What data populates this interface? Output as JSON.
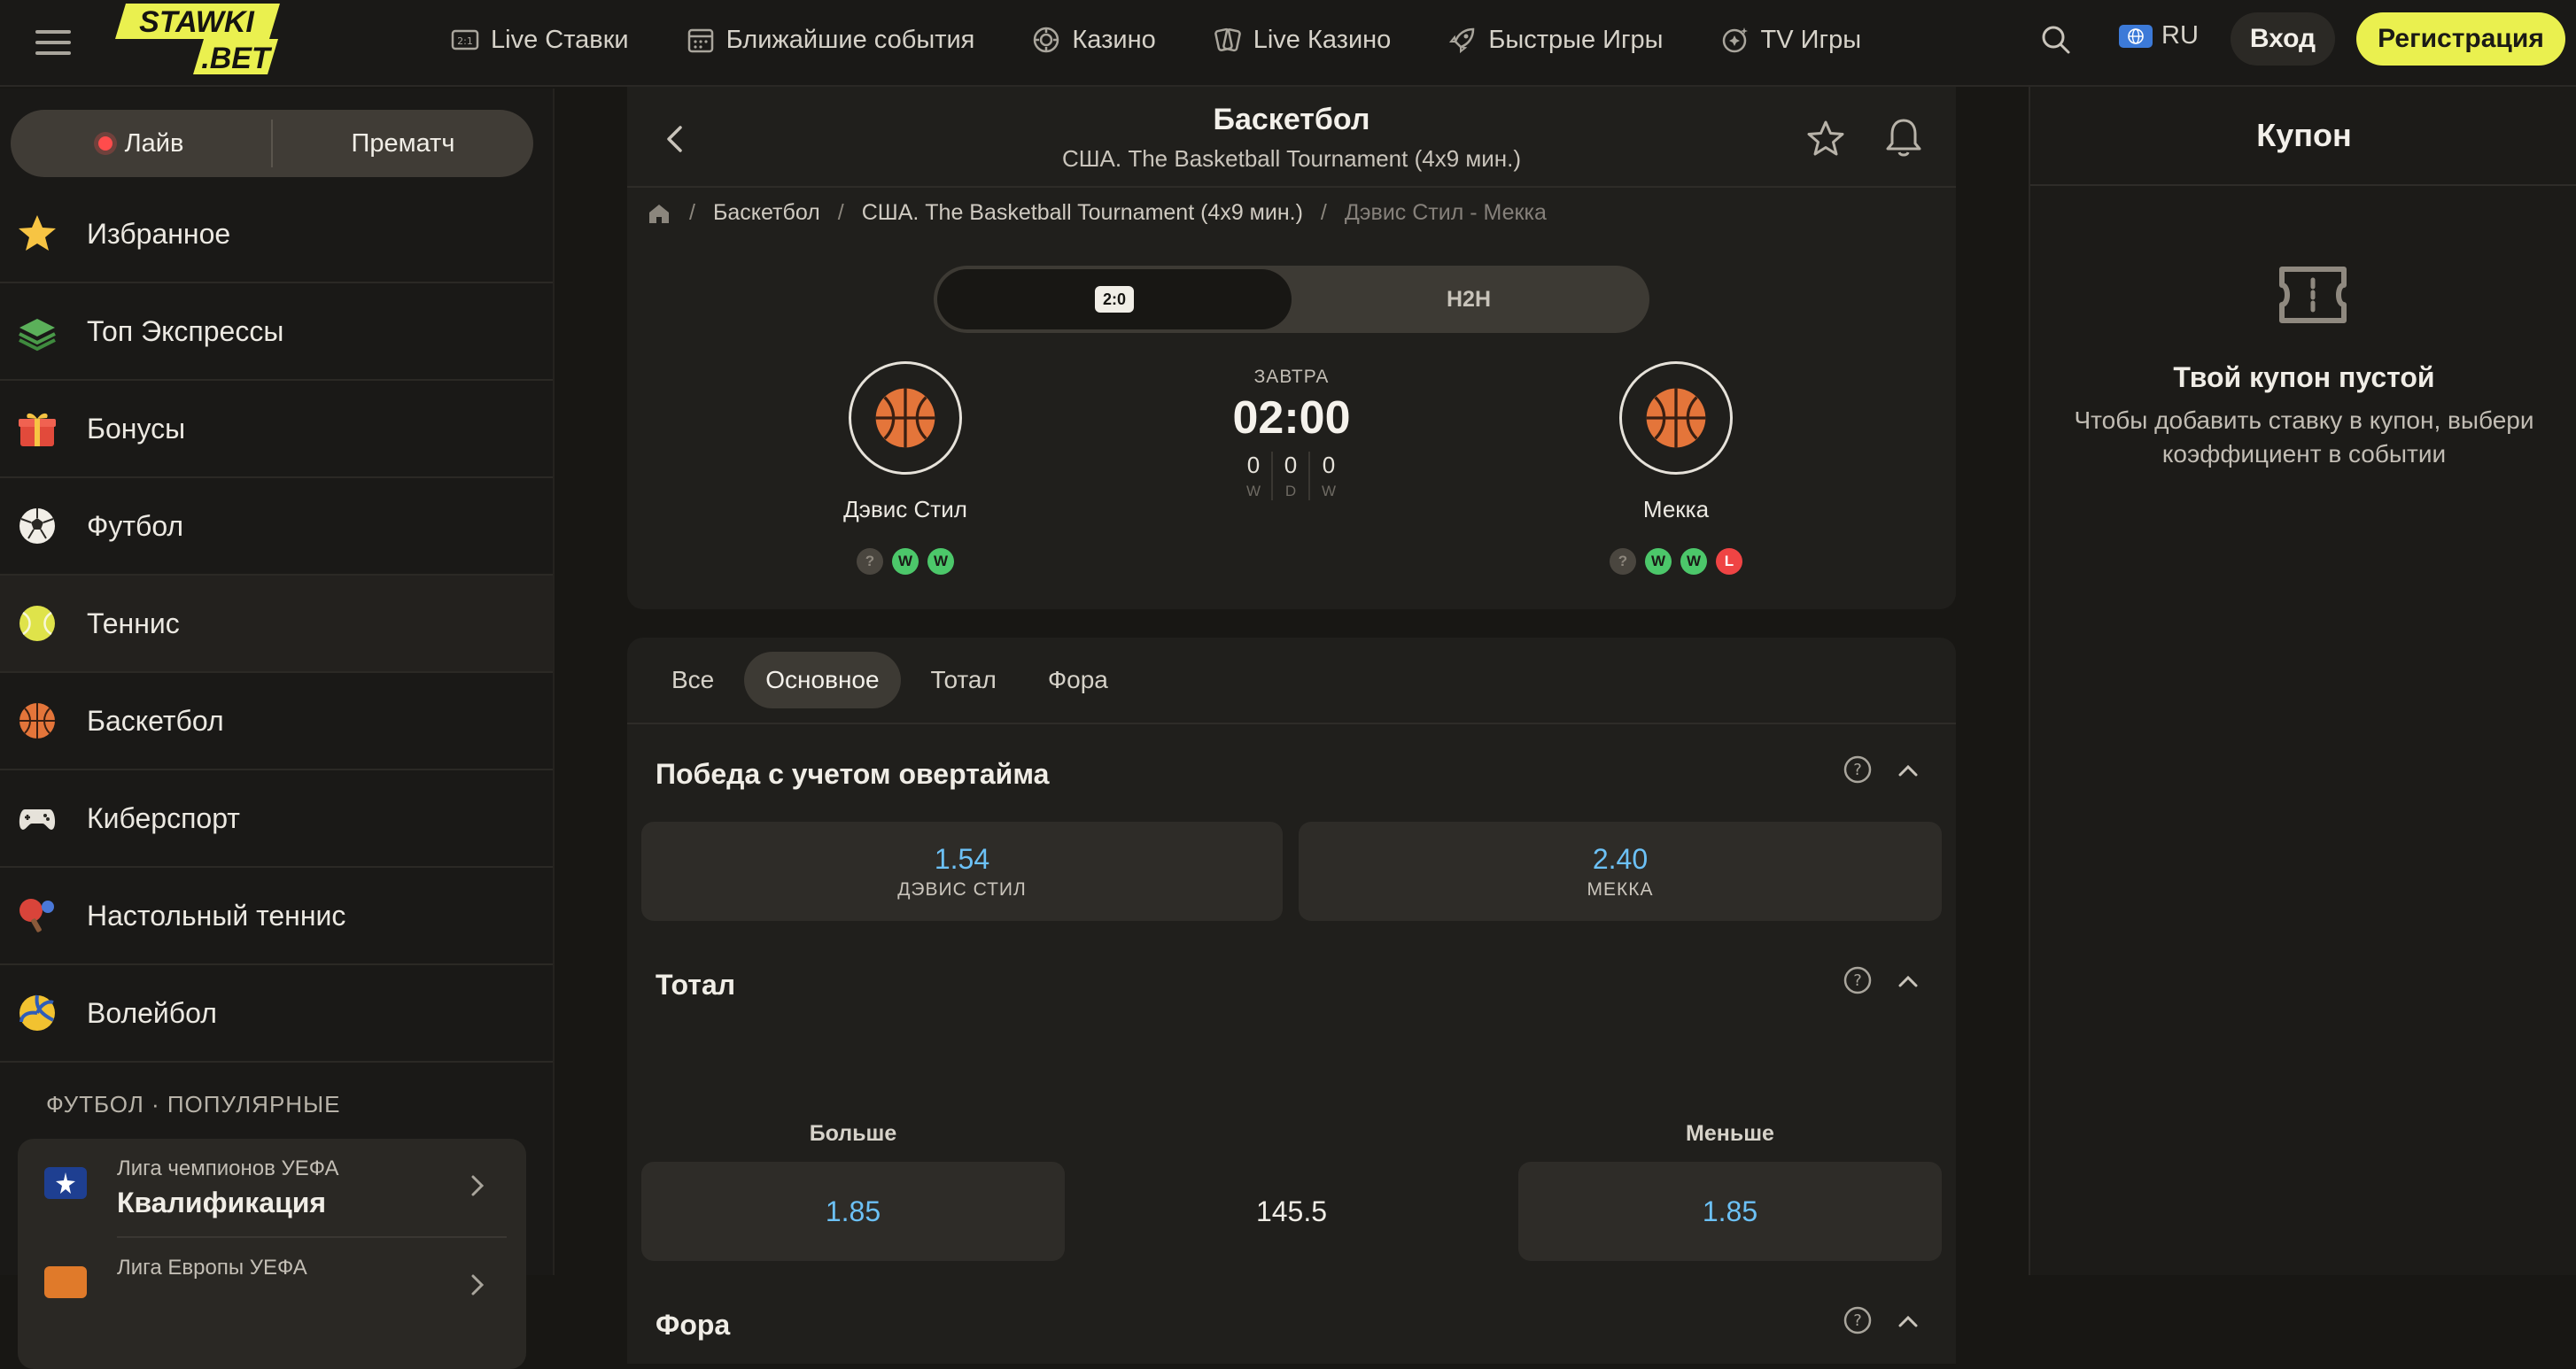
{
  "header": {
    "logo_text": "STAWKI.BET",
    "nav": [
      {
        "label": "Live Ставки",
        "icon": "scoreboard-icon"
      },
      {
        "label": "Ближайшие события",
        "icon": "calendar-icon"
      },
      {
        "label": "Казино",
        "icon": "casino-chip-icon"
      },
      {
        "label": "Live Казино",
        "icon": "cards-icon"
      },
      {
        "label": "Быстрые Игры",
        "icon": "rocket-icon"
      },
      {
        "label": "TV Игры",
        "icon": "tv-games-icon"
      }
    ],
    "lang": "RU",
    "login": "Вход",
    "register": "Регистрация"
  },
  "colors": {
    "accent": "#eaf04f",
    "odds": "#6cc1f6",
    "win": "#4cc76a",
    "loss": "#ef4444",
    "live": "#ff4c4c"
  },
  "sidebar": {
    "live": "Лайв",
    "prematch": "Прематч",
    "items": [
      {
        "label": "Избранное",
        "icon": "star-icon"
      },
      {
        "label": "Топ Экспрессы",
        "icon": "layers-icon"
      },
      {
        "label": "Бонусы",
        "icon": "gift-icon"
      },
      {
        "label": "Футбол",
        "icon": "soccer-ball-icon"
      },
      {
        "label": "Теннис",
        "icon": "tennis-ball-icon",
        "active": true
      },
      {
        "label": "Баскетбол",
        "icon": "basketball-icon"
      },
      {
        "label": "Киберспорт",
        "icon": "gamepad-icon"
      },
      {
        "label": "Настольный теннис",
        "icon": "ping-pong-icon"
      },
      {
        "label": "Волейбол",
        "icon": "volleyball-icon"
      }
    ],
    "section_title": "ФУТБОЛ · ПОПУЛЯРНЫЕ",
    "leagues": [
      {
        "small": "Лига чемпионов УЕФА",
        "big": "Квалификация"
      },
      {
        "small": "Лига Европы УЕФА",
        "big": ""
      }
    ]
  },
  "match": {
    "title": "Баскетбол",
    "subtitle": "США. The Basketball Tournament (4x9 мин.)",
    "breadcrumbs": [
      "Баскетбол",
      "США. The Basketball Tournament (4x9 мин.)",
      "Дэвис Стил - Мекка"
    ],
    "tab_score": "2:0",
    "tab_h2h": "H2H",
    "when": "ЗАВТРА",
    "time": "02:00",
    "h2h": [
      {
        "n": "0",
        "l": "W"
      },
      {
        "n": "0",
        "l": "D"
      },
      {
        "n": "0",
        "l": "W"
      }
    ],
    "home": {
      "name": "Дэвис Стил",
      "form": [
        "?",
        "W",
        "W"
      ]
    },
    "away": {
      "name": "Мекка",
      "form": [
        "?",
        "W",
        "W",
        "L"
      ]
    }
  },
  "markets": {
    "tabs": [
      "Все",
      "Основное",
      "Тотал",
      "Фора"
    ],
    "active_tab": 1,
    "winner": {
      "title": "Победа с учетом овертайма",
      "home_odd": "1.54",
      "home_name": "ДЭВИС СТИЛ",
      "away_odd": "2.40",
      "away_name": "МЕККА"
    },
    "total": {
      "title": "Тотал",
      "over_label": "Больше",
      "under_label": "Меньше",
      "over_odd": "1.85",
      "line": "145.5",
      "under_odd": "1.85"
    },
    "handicap": {
      "title": "Фора"
    }
  },
  "coupon": {
    "title": "Купон",
    "empty_title": "Твой купон пустой",
    "empty_hint": "Чтобы добавить ставку в купон, выбери коэффициент в событии"
  }
}
